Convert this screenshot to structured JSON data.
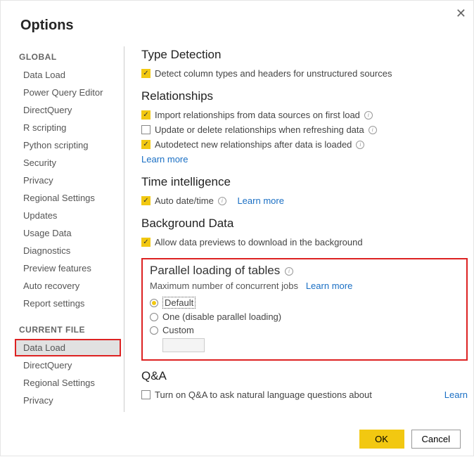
{
  "dialog": {
    "title": "Options"
  },
  "sidebar": {
    "groups": [
      {
        "header": "GLOBAL",
        "items": [
          {
            "label": "Data Load"
          },
          {
            "label": "Power Query Editor"
          },
          {
            "label": "DirectQuery"
          },
          {
            "label": "R scripting"
          },
          {
            "label": "Python scripting"
          },
          {
            "label": "Security"
          },
          {
            "label": "Privacy"
          },
          {
            "label": "Regional Settings"
          },
          {
            "label": "Updates"
          },
          {
            "label": "Usage Data"
          },
          {
            "label": "Diagnostics"
          },
          {
            "label": "Preview features"
          },
          {
            "label": "Auto recovery"
          },
          {
            "label": "Report settings"
          }
        ]
      },
      {
        "header": "CURRENT FILE",
        "items": [
          {
            "label": "Data Load",
            "selected": true
          },
          {
            "label": "DirectQuery"
          },
          {
            "label": "Regional Settings"
          },
          {
            "label": "Privacy"
          }
        ]
      }
    ]
  },
  "content": {
    "typeDetection": {
      "heading": "Type Detection",
      "opt1": "Detect column types and headers for unstructured sources"
    },
    "relationships": {
      "heading": "Relationships",
      "opt1": "Import relationships from data sources on first load",
      "opt2": "Update or delete relationships when refreshing data",
      "opt3": "Autodetect new relationships after data is loaded",
      "learn": "Learn more"
    },
    "timeIntel": {
      "heading": "Time intelligence",
      "opt1": "Auto date/time",
      "learn": "Learn more"
    },
    "backgroundData": {
      "heading": "Background Data",
      "opt1": "Allow data previews to download in the background"
    },
    "parallel": {
      "heading": "Parallel loading of tables",
      "sub": "Maximum number of concurrent jobs",
      "learn": "Learn more",
      "r1": "Default",
      "r2": "One (disable parallel loading)",
      "r3": "Custom"
    },
    "qna": {
      "heading": "Q&A",
      "opt1": "Turn on Q&A to ask natural language questions about",
      "learn": "Learn"
    }
  },
  "footer": {
    "ok": "OK",
    "cancel": "Cancel"
  }
}
